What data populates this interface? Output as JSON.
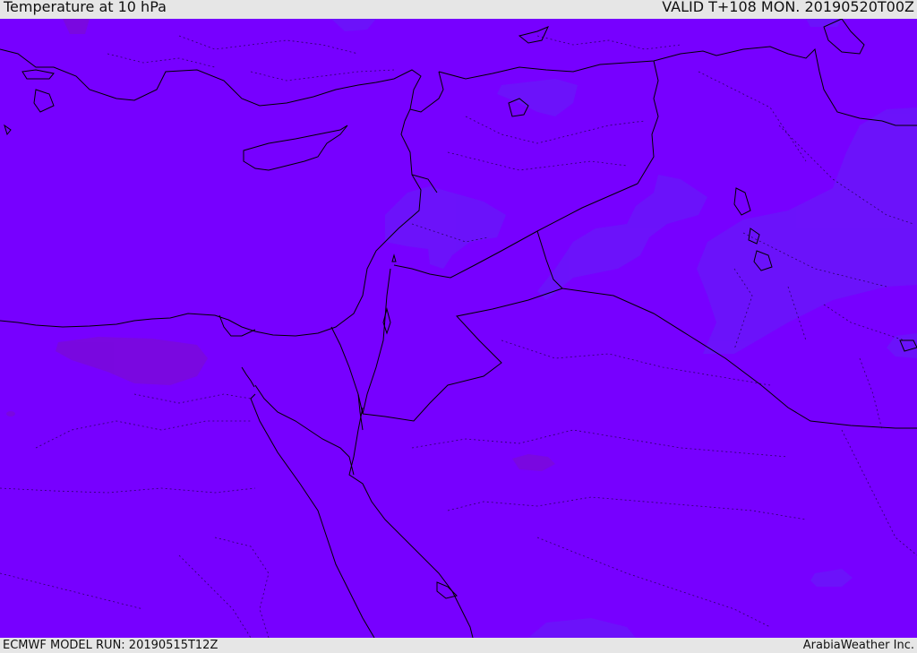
{
  "header": {
    "title": "Temperature at 10 hPa",
    "valid_time": "VALID T+108 MON. 20190520T00Z"
  },
  "footer": {
    "model_run": "ECMWF MODEL RUN: 20190515T12Z",
    "credit": "ArabiaWeather Inc."
  },
  "map": {
    "field": "temperature",
    "pressure_level": "10 hPa",
    "colors": {
      "base_fill": "#7700ff",
      "cooler_patch": "#6a14fa",
      "warmer_patch": "#7a0ad8",
      "coastline": "#000000",
      "internal_border": "#1a0040"
    }
  }
}
